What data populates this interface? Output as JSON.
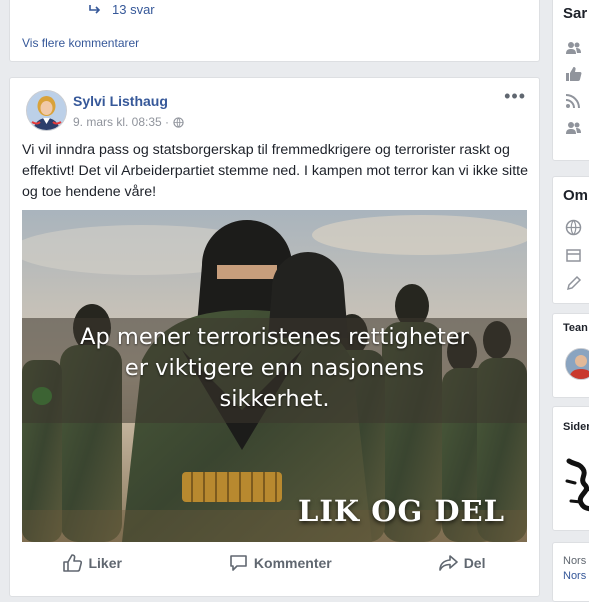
{
  "feed": {
    "top": {
      "reply_count": "13 svar",
      "more_comments": "Vis flere kommentarer"
    },
    "post": {
      "author": "Sylvi Listhaug",
      "timestamp": "9. mars kl. 08:35 ·",
      "more_icon": "•••",
      "text": "Vi vil inndra pass og statsborgerskap til fremmedkrigere og terrorister raskt og effektivt! Det vil Arbeiderpartiet stemme ned. I kampen mot terror kan vi ikke sitte og toe hendene våre!",
      "image": {
        "lines": [
          "Ap mener terroristenes rettigheter",
          "er viktigere enn nasjonens",
          "sikkerhet."
        ],
        "stamp": "LIK OG DEL"
      },
      "actions": {
        "like": "Liker",
        "comment": "Kommenter",
        "share": "Del"
      }
    }
  },
  "sidebar": {
    "card1_title": "Sar",
    "card2_title": "Om",
    "card3_title": "Tean",
    "card4_title": "Sider",
    "card5_line1": "Nors",
    "card5_line2": "Nors"
  },
  "colors": {
    "link": "#365899",
    "background": "#e9ebee",
    "muted": "#90949c"
  }
}
